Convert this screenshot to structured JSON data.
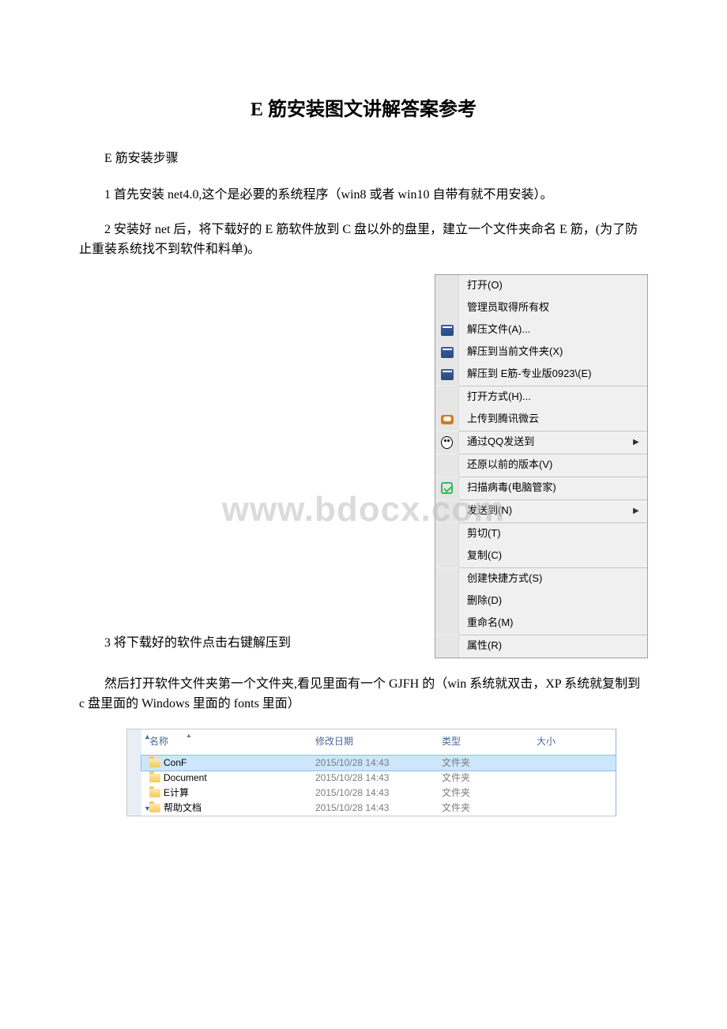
{
  "title": "E 筋安装图文讲解答案参考",
  "p1": "E 筋安装步骤",
  "p2": "1 首先安装 net4.0,这个是必要的系统程序（win8 或者 win10 自带有就不用安装）。",
  "p3": "2 安装好 net 后，将下载好的 E 筋软件放到 C 盘以外的盘里，建立一个文件夹命名 E 筋，(为了防止重装系统找不到软件和料单)。",
  "p4label": "3 将下载好的软件点击右键解压到",
  "p5": "然后打开软件文件夹第一个文件夹,看见里面有一个 GJFH 的（win 系统就双击，XP 系统就复制到 c 盘里面的 Windows 里面的 fonts 里面）",
  "watermark": "www.bdocx.com",
  "menu": {
    "open": "打开(O)",
    "admin": "管理员取得所有权",
    "extractA": "解压文件(A)...",
    "extractX": "解压到当前文件夹(X)",
    "extractE": "解压到 E筋-专业版0923\\(E)",
    "openWith": "打开方式(H)...",
    "uploadWeiyun": "上传到腾讯微云",
    "qqSend": "通过QQ发送到",
    "restore": "还原以前的版本(V)",
    "scan": "扫描病毒(电脑管家)",
    "sendTo": "发送到(N)",
    "cut": "剪切(T)",
    "copy": "复制(C)",
    "shortcut": "创建快捷方式(S)",
    "delete": "删除(D)",
    "rename": "重命名(M)",
    "properties": "属性(R)"
  },
  "explorer": {
    "headers": {
      "name": "名称",
      "date": "修改日期",
      "type": "类型",
      "size": "大小"
    },
    "rows": [
      {
        "name": "ConF",
        "date": "2015/10/28 14:43",
        "type": "文件夹"
      },
      {
        "name": "Document",
        "date": "2015/10/28 14:43",
        "type": "文件夹"
      },
      {
        "name": "E计算",
        "date": "2015/10/28 14:43",
        "type": "文件夹"
      },
      {
        "name": "帮助文档",
        "date": "2015/10/28 14:43",
        "type": "文件夹"
      }
    ]
  }
}
